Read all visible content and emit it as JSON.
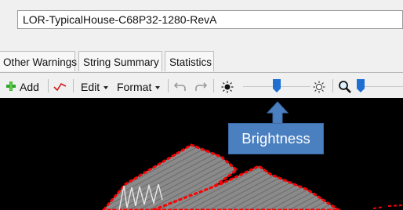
{
  "project": {
    "name": "LOR-TypicalHouse-C68P32-1280-RevA"
  },
  "tabs": [
    {
      "label": "Other Warnings"
    },
    {
      "label": "String Summary"
    },
    {
      "label": "Statistics"
    }
  ],
  "toolbar": {
    "add_label": "Add",
    "edit_label": "Edit",
    "format_label": "Format",
    "icons": {
      "add": "green-plus-icon",
      "line": "red-line-icon",
      "undo": "undo-icon",
      "redo": "redo-icon",
      "brightness_low": "sun-dark-icon",
      "brightness_high": "sun-light-icon",
      "zoom": "magnifier-icon"
    },
    "brightness_level": 0.5,
    "zoom_level": 0.08
  },
  "callout": {
    "text": "Brightness",
    "color": "#4a7fc0"
  },
  "colors": {
    "accent": "#1e6fd1",
    "outline": "#ff0000",
    "roof": "#8a8a8a",
    "canvas": "#000000"
  }
}
